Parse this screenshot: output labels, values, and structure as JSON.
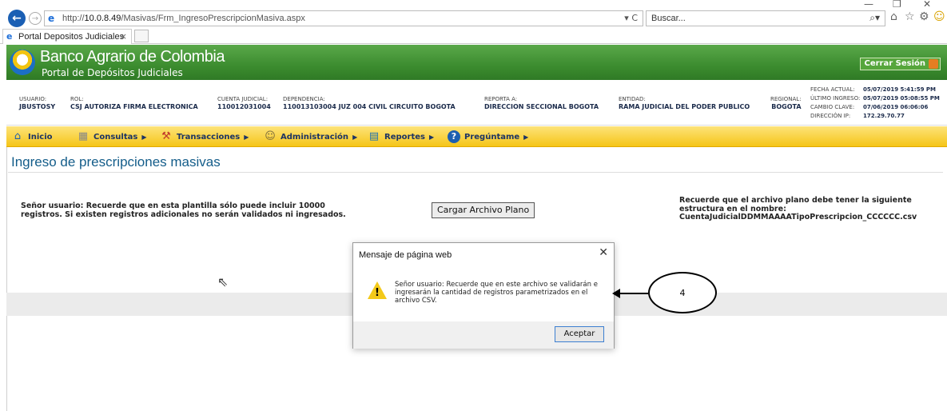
{
  "browser": {
    "url_prefix": "http://",
    "url_host": "10.0.8.49",
    "url_path": "/Masivas/Frm_IngresoPrescripcionMasiva.aspx",
    "addr_tools": "▾ C",
    "search_placeholder": "Buscar...",
    "tab_title": "Portal Depositos Judiciales",
    "tab_close": "×"
  },
  "site": {
    "title": "Banco Agrario de Colombia",
    "subtitle": "Portal de Depósitos Judiciales",
    "logout_label": "Cerrar Sesión"
  },
  "info": {
    "usuario_lbl": "USUARIO:",
    "usuario_val": "JBUSTOSY",
    "rol_lbl": "ROL:",
    "rol_val": "CSJ AUTORIZA FIRMA ELECTRONICA",
    "cuenta_lbl": "CUENTA JUDICIAL:",
    "cuenta_val": "110012031004",
    "dependencia_lbl": "DEPENDENCIA:",
    "dependencia_val": "110013103004 JUZ 004 CIVIL CIRCUITO BOGOTA",
    "reporta_lbl": "REPORTA A:",
    "reporta_val": "DIRECCION SECCIONAL BOGOTA",
    "entidad_lbl": "ENTIDAD:",
    "entidad_val": "RAMA JUDICIAL DEL PODER PUBLICO",
    "regional_lbl": "REGIONAL:",
    "regional_val": "BOGOTA",
    "fecha_lbl": "FECHA ACTUAL:",
    "fecha_val": "05/07/2019 5:41:59 PM",
    "ultimo_lbl": "ÚLTIMO INGRESO:",
    "ultimo_val": "05/07/2019 05:08:55 PM",
    "cambio_lbl": "CAMBIO CLAVE:",
    "cambio_val": "07/06/2019 06:06:06",
    "ip_lbl": "DIRECCIÓN IP:",
    "ip_val": "172.29.70.77"
  },
  "menu": {
    "inicio": "Inicio",
    "consultas": "Consultas",
    "transacciones": "Transacciones",
    "administracion": "Administración",
    "reportes": "Reportes",
    "preguntame": "Pregúntame"
  },
  "page": {
    "title": "Ingreso de prescripciones masivas",
    "left_note": "Señor usuario: Recuerde que en esta plantilla sólo puede incluir 10000 registros. Si existen registros adicionales no serán validados ni ingresados.",
    "upload_button": "Cargar Archivo Plano",
    "right_note_1": "Recuerde que el archivo plano debe tener la siguiente estructura en el nombre:",
    "right_note_2": "CuentaJudicialDDMMAAAATipoPrescripcion_CCCCCC.csv"
  },
  "dialog": {
    "title": "Mensaje de página web",
    "close": "✕",
    "message": "Señor usuario: Recuerde que en este archivo se validarán e ingresarán la cantidad de registros parametrizados en el archivo CSV.",
    "ok_label": "Aceptar"
  },
  "callout": {
    "number": "4"
  }
}
